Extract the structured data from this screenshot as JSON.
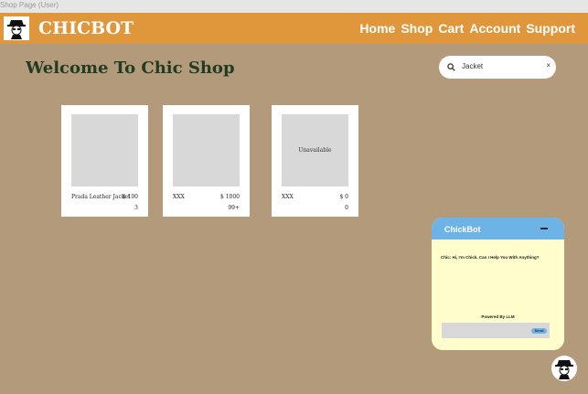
{
  "frame": {
    "title": "Shop Page (User)"
  },
  "header": {
    "brand": "CHICBOT",
    "nav": [
      "Home",
      "Shop",
      "Cart",
      "Account",
      "Support"
    ]
  },
  "main": {
    "welcome": "Welcome To Chic Shop"
  },
  "search": {
    "value": "Jacket",
    "clear": "×"
  },
  "products": [
    {
      "name": "Prada Leather Jacket",
      "price": "$ 100",
      "stock": "3",
      "image_text": ""
    },
    {
      "name": "XXX",
      "price": "$ 1000",
      "stock": "99+",
      "image_text": ""
    },
    {
      "name": "XXX",
      "price": "$ 0",
      "stock": "0",
      "image_text": "Unavailable"
    }
  ],
  "chat": {
    "title": "ChickBot",
    "message": "Chic: Hi, I'm Chick. Can I Help You With Anything?",
    "powered": "Powered By  LLM",
    "input_value": "",
    "send_label": "Send"
  },
  "colors": {
    "background": "#b29a7a",
    "topbar": "#e0973c",
    "welcome_text": "#233b23",
    "chat_header": "#6eb3e6",
    "chat_body": "#fefdcb"
  },
  "icons": {
    "logo": "detective-avatar-icon",
    "search": "search-icon",
    "minimize": "minimize-icon",
    "bot": "bot-avatar-icon"
  }
}
